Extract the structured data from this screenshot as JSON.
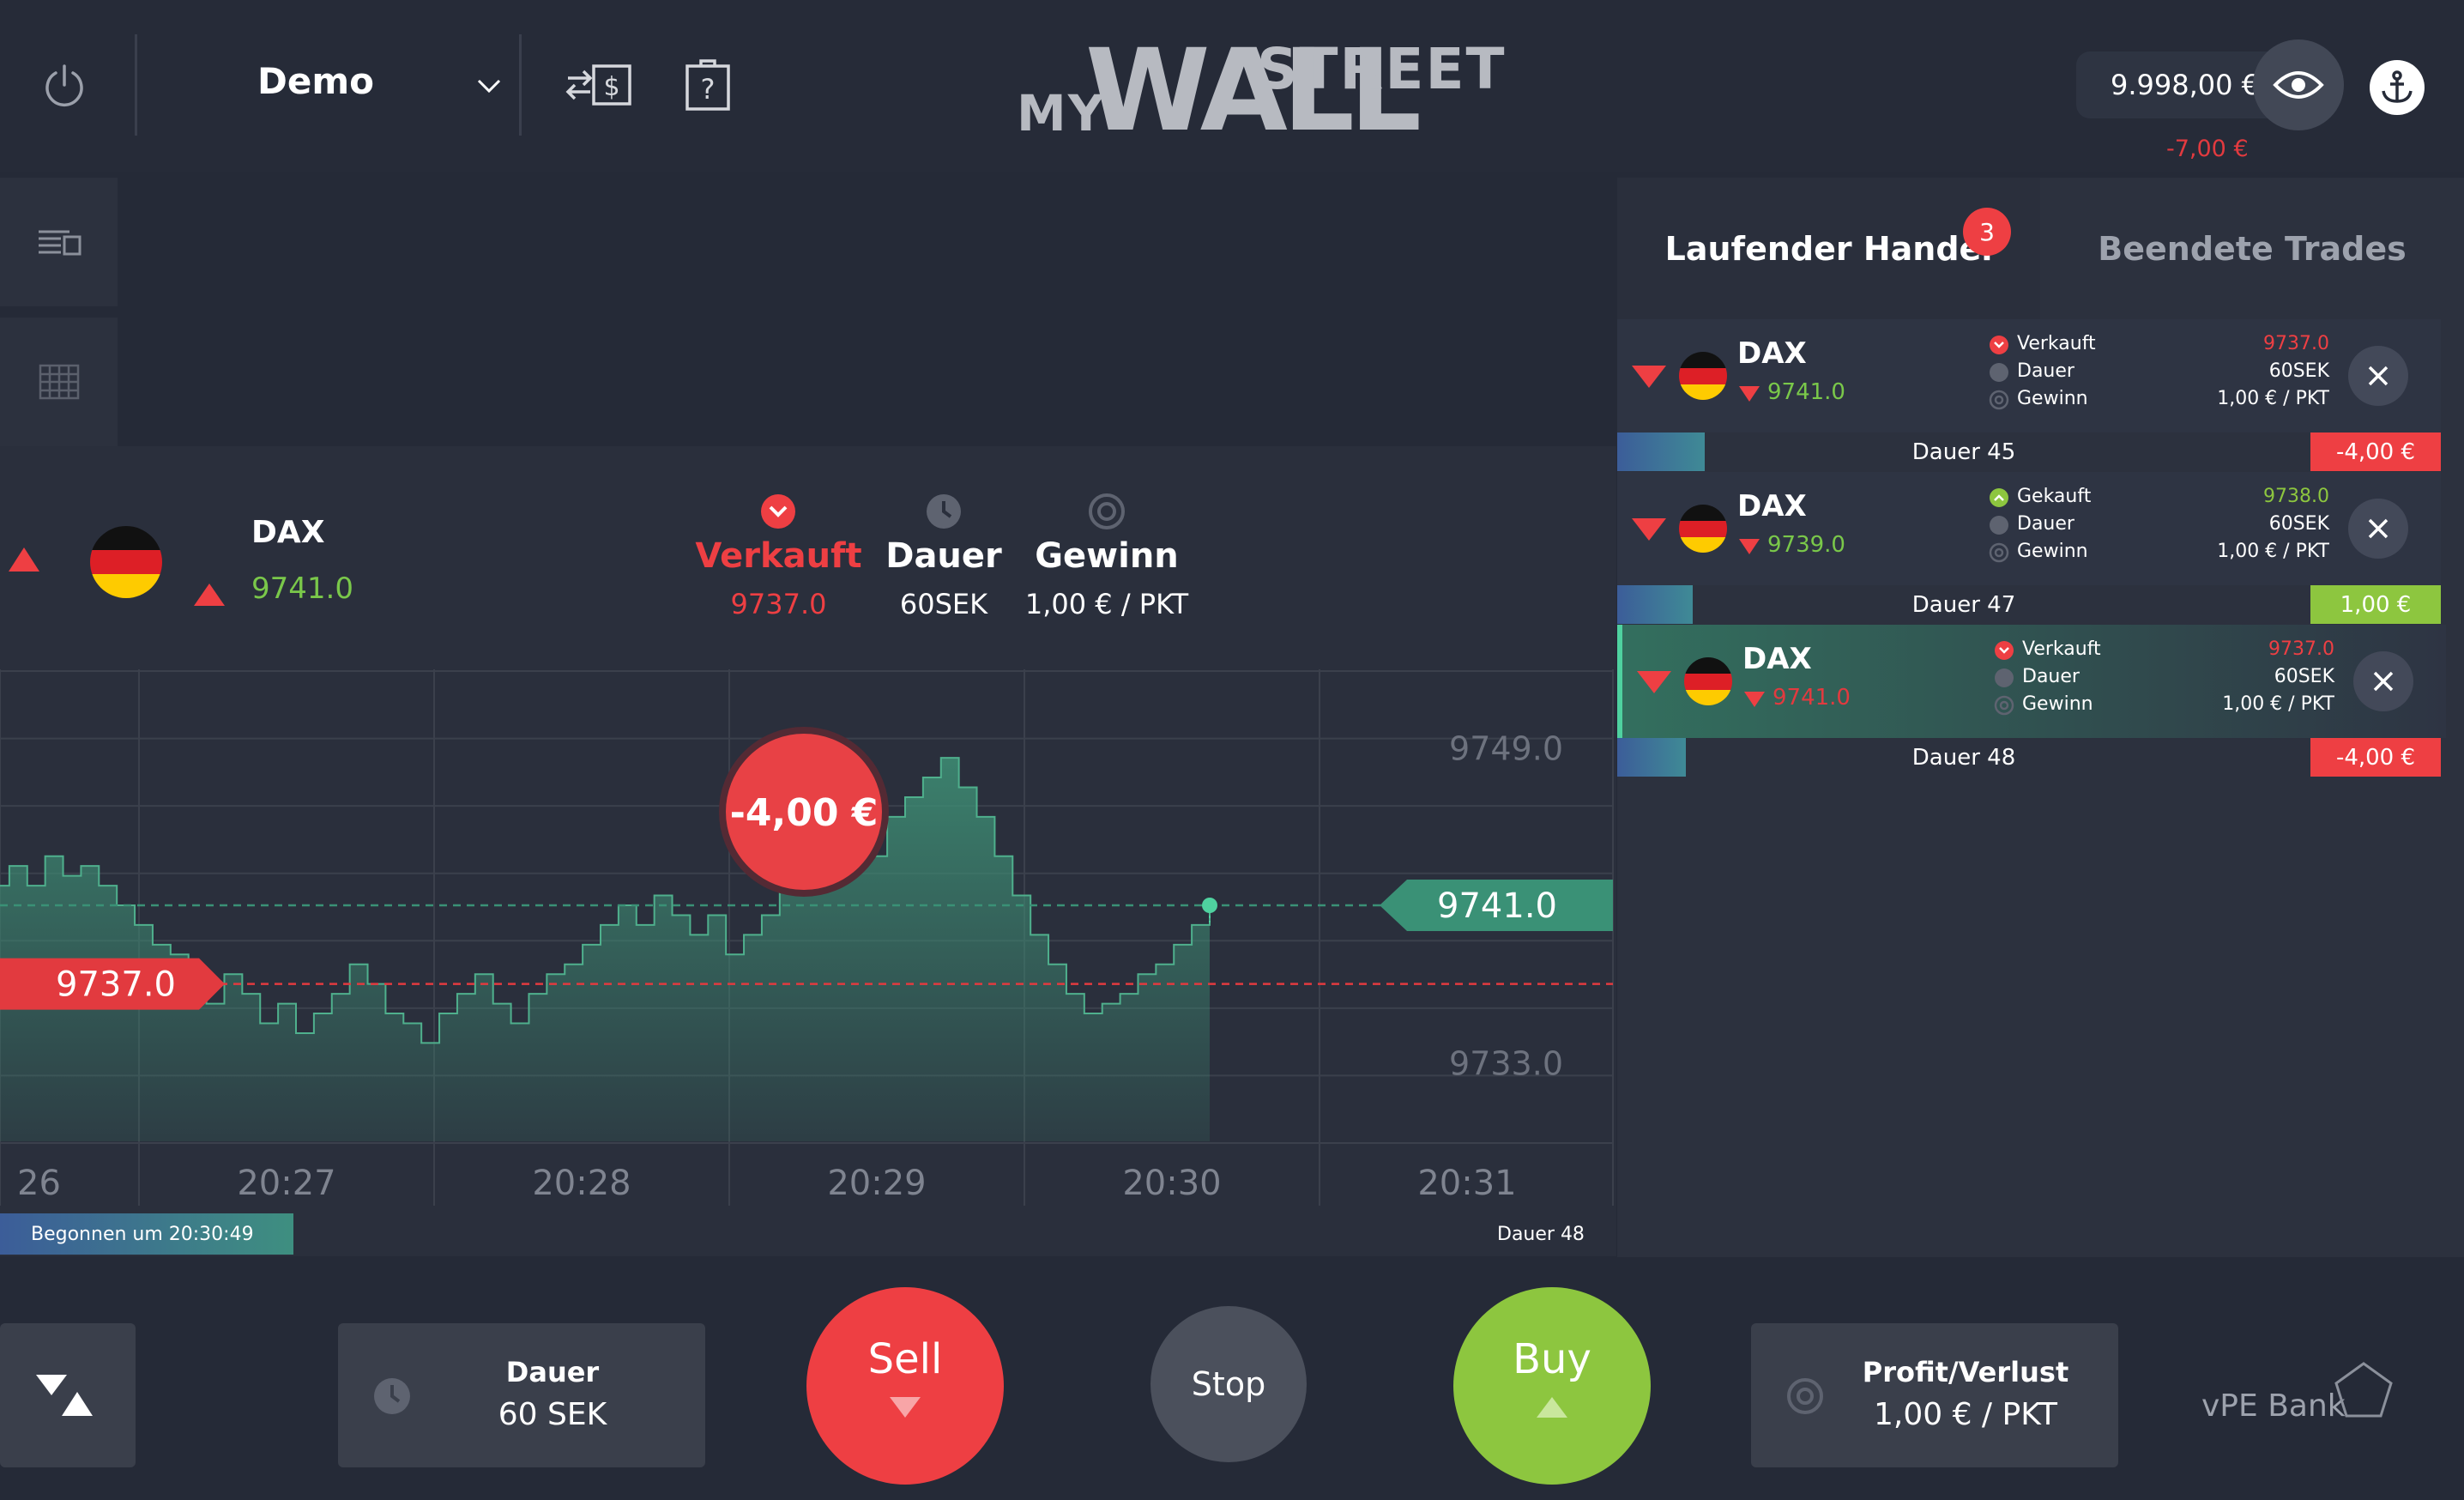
{
  "topbar": {
    "account_label": "Demo",
    "logo_my": "MY",
    "logo_wall": "WALL",
    "logo_street": "STREET",
    "balance": "9.998,00 €",
    "balance_change": "-7,00 €"
  },
  "asset": {
    "name": "DAX",
    "price": "9741.0"
  },
  "order_info": {
    "direction_label": "Verkauft",
    "direction_price": "9737.0",
    "duration_label": "Dauer",
    "duration_value": "60SEK",
    "profit_label": "Gewinn",
    "profit_value": "1,00 € / PKT"
  },
  "chart_data": {
    "type": "area",
    "title": "",
    "xlabel": "",
    "ylabel": "",
    "x_ticks": [
      "26",
      "20:27",
      "20:28",
      "20:29",
      "20:30",
      "20:31"
    ],
    "y_ticks": [
      "9749.0",
      "9733.0"
    ],
    "ylim": [
      9729,
      9753
    ],
    "grid": true,
    "series": [
      {
        "values": [
          9742.0,
          9743.0,
          9742.0,
          9743.5,
          9742.5,
          9743.0,
          9742.0,
          9741.0,
          9740.0,
          9739.0,
          9738.5,
          9737.0,
          9736.0,
          9737.5,
          9736.5,
          9735.0,
          9736.0,
          9734.5,
          9735.5,
          9736.5,
          9738.0,
          9737.0,
          9735.5,
          9735.0,
          9734.0,
          9735.5,
          9736.5,
          9737.5,
          9736.0,
          9735.0,
          9736.5,
          9737.5,
          9738.0,
          9739.0,
          9740.0,
          9741.0,
          9740.0,
          9741.5,
          9740.5,
          9739.5,
          9740.5,
          9738.5,
          9739.5,
          9740.5,
          9742.0,
          9743.0,
          9744.5,
          9743.5,
          9744.5,
          9743.5,
          9745.5,
          9746.5,
          9747.5,
          9748.5,
          9747.0,
          9745.5,
          9743.5,
          9741.5,
          9739.5,
          9738.0,
          9736.5,
          9735.5,
          9736.0,
          9736.5,
          9737.5,
          9738.0,
          9739.0,
          9740.0,
          9741.0
        ],
        "x_start": 20.4333,
        "x_end": 20.5136
      }
    ],
    "reference_lines": [
      {
        "label": "9741.0",
        "value": 9741.0,
        "color": "#3a9176"
      },
      {
        "label": "9737.0",
        "value": 9737.0,
        "color": "#e23a3f"
      }
    ],
    "annotation": "-4,00 €"
  },
  "chart_footer": {
    "started": "Begonnen um 20:30:49",
    "duration": "Dauer 48"
  },
  "tabs": {
    "running": "Laufender Handel",
    "running_count": "3",
    "finished": "Beendete Trades"
  },
  "trades": [
    {
      "name": "DAX",
      "price": "9741.0",
      "action": "Verkauft",
      "action_price": "9737.0",
      "duration_label": "Dauer",
      "duration_value": "60SEK",
      "profit_label": "Gewinn",
      "profit_value": "1,00 € / PKT",
      "duration_bar": "Dauer 45",
      "pl": "-4,00 €",
      "progress": 0.106
    },
    {
      "name": "DAX",
      "price": "9739.0",
      "action": "Gekauft",
      "action_price": "9738.0",
      "duration_label": "Dauer",
      "duration_value": "60SEK",
      "profit_label": "Gewinn",
      "profit_value": "1,00 € / PKT",
      "duration_bar": "Dauer 47",
      "pl": "1,00 €",
      "progress": 0.092
    },
    {
      "name": "DAX",
      "price": "9741.0",
      "action": "Verkauft",
      "action_price": "9737.0",
      "duration_label": "Dauer",
      "duration_value": "60SEK",
      "profit_label": "Gewinn",
      "profit_value": "1,00 € / PKT",
      "duration_bar": "Dauer 48",
      "pl": "-4,00 €",
      "progress": 0.083
    }
  ],
  "bottom": {
    "duration_label": "Dauer",
    "duration_value": "60 SEK",
    "sell": "Sell",
    "stop": "Stop",
    "buy": "Buy",
    "pl_label": "Profit/Verlust",
    "pl_value": "1,00 € / PKT",
    "bank": "vPE Bank"
  },
  "colors": {
    "sell": "#ee3f43",
    "buy": "#8dc63f",
    "accent_green": "#3e8f75"
  }
}
